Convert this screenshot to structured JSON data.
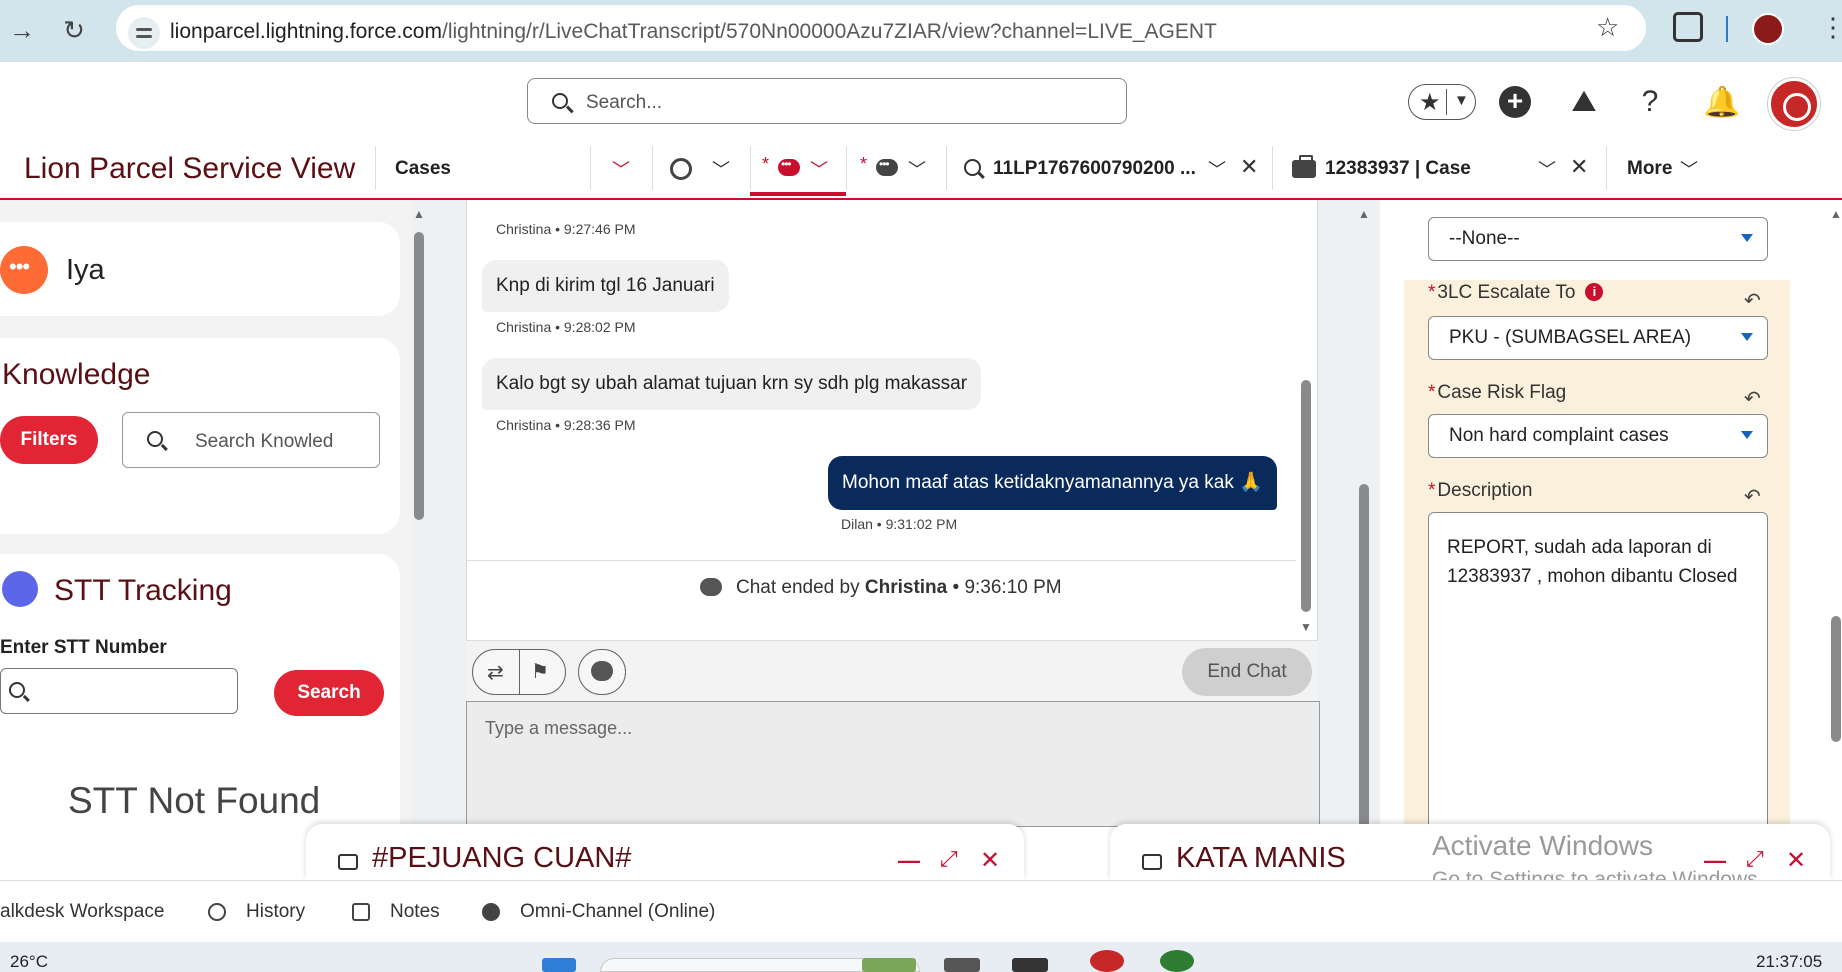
{
  "browser": {
    "url_main": "lionparcel.lightning.force.com",
    "url_path": "/lightning/r/LiveChatTranscript/570Nn00000Azu7ZIAR/view?channel=LIVE_AGENT"
  },
  "header": {
    "search_placeholder": "Search..."
  },
  "nav": {
    "app_name": "Lion Parcel Service View",
    "object_tab": "Cases",
    "asterisk": "*",
    "tab_search_record": "11LP1767600790200 ...",
    "tab_case": "12383937 | Case",
    "more_label": "More"
  },
  "left_panel": {
    "iya_label": "Iya",
    "knowledge_title": "Knowledge",
    "filters_button": "Filters",
    "knowledge_search_placeholder": "Search Knowled",
    "stt_title": "STT Tracking",
    "stt_input_label": "Enter STT Number",
    "stt_search_button": "Search",
    "stt_result": "STT Not Found"
  },
  "chat": {
    "messages": [
      {
        "meta": "Christina • 9:27:46 PM"
      },
      {
        "text": "Knp di kirim tgl 16 Januari",
        "meta": "Christina • 9:28:02 PM"
      },
      {
        "text": "Kalo bgt sy ubah alamat tujuan krn sy sdh plg makassar",
        "meta": "Christina • 9:28:36 PM"
      },
      {
        "text": "Mohon maaf atas ketidaknyamanannya ya kak 🙏",
        "meta": "Dilan • 9:31:02 PM"
      }
    ],
    "ended_prefix": "Chat ended by ",
    "ended_by": "Christina",
    "ended_time": " • 9:36:10 PM",
    "end_chat_button": "End Chat",
    "message_placeholder": "Type a message..."
  },
  "case_form": {
    "top_select_value": "--None--",
    "required_mark": "*",
    "escalate_label": "3LC Escalate To",
    "escalate_value": "PKU - (SUMBAGSEL AREA)",
    "risk_label": "Case Risk Flag",
    "risk_value": "Non hard complaint cases",
    "description_label": "Description",
    "description_value": "REPORT, sudah ada laporan di 12383937 , mohon dibantu Closed"
  },
  "docked": {
    "window1_title": "#PEJUANG CUAN#",
    "window2_title": "KATA MANIS"
  },
  "watermark": {
    "line1": "Activate Windows",
    "line2": "Go to Settings to activate Windows."
  },
  "utility_bar": {
    "talkdesk": "alkdesk Workspace",
    "history": "History",
    "notes": "Notes",
    "omni": "Omni-Channel (Online)"
  },
  "taskbar": {
    "temperature": "26°C",
    "clock": "21:37:05"
  },
  "colors": {
    "brand_red": "#c8102e",
    "chat_agent_bubble": "#0b2a5c",
    "app_title": "#5a0f14"
  }
}
